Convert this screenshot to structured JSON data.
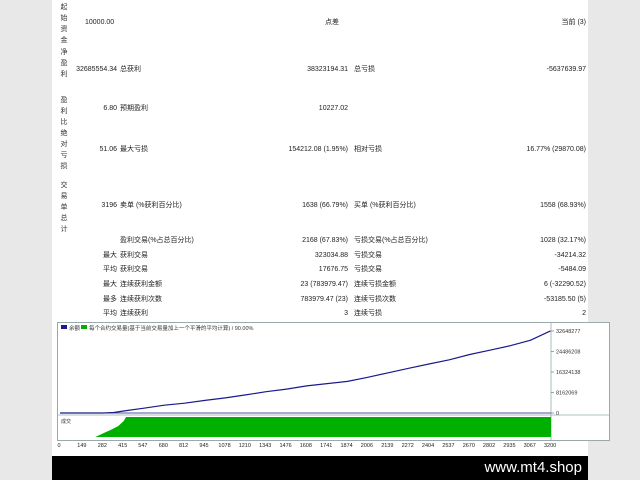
{
  "sidebar_labels": [
    "起始资金",
    "净盈利",
    "盈利比",
    "绝对亏损",
    "交易单总计"
  ],
  "stats": {
    "initial_deposit": "10000.00",
    "spread_label": "点差",
    "spread_value": "当前 (3)",
    "net_profit": "32685554.34",
    "gross_profit_label": "总获利",
    "gross_profit": "38323194.31",
    "gross_loss_label": "总亏损",
    "gross_loss": "-5637639.97",
    "profit_factor": "6.80",
    "expected_payoff_label": "预期盈利",
    "expected_payoff": "10227.02",
    "absolute_drawdown": "51.06",
    "maximal_drawdown_label": "最大亏损",
    "maximal_drawdown": "154212.08 (1.95%)",
    "relative_drawdown_label": "相对亏损",
    "relative_drawdown": "16.77% (29870.08)",
    "total_trades": "3196",
    "short_label": "卖单 (%获利百分比)",
    "short_value": "1638 (66.79%)",
    "long_label": "买单 (%获利百分比)",
    "long_value": "1558 (68.93%)",
    "profit_trades_label": "盈利交易(%占总百分比)",
    "profit_trades": "2168 (67.83%)",
    "loss_trades_label": "亏损交易(%占总百分比)",
    "loss_trades": "1028 (32.17%)"
  },
  "detail_rows": [
    {
      "prefix": "最大",
      "l1": "获利交易",
      "v1": "323034.88",
      "l2": "亏损交易",
      "v2": "-34214.32"
    },
    {
      "prefix": "平均",
      "l1": "获利交易",
      "v1": "17676.75",
      "l2": "亏损交易",
      "v2": "-5484.09"
    },
    {
      "prefix": "最大",
      "l1": "连续获利金额",
      "v1": "23 (783979.47)",
      "l2": "连续亏损金额",
      "v2": "6 (-32290.52)"
    },
    {
      "prefix": "最多",
      "l1": "连续获利次数",
      "v1": "783979.47 (23)",
      "l2": "连续亏损次数",
      "v2": "-53185.50 (5)"
    },
    {
      "prefix": "平均",
      "l1": "连续获利",
      "v1": "3",
      "l2": "连续亏损",
      "v2": "2"
    }
  ],
  "chart_data": {
    "type": "line",
    "legend_balance": "余额",
    "legend_text": "每个合约交易量(基于当前交易量加上一个平滑的平均计算) / 90.00%",
    "volume_label": "成交",
    "x_ticks": [
      "0",
      "149",
      "282",
      "415",
      "547",
      "680",
      "812",
      "945",
      "1078",
      "1210",
      "1343",
      "1476",
      "1608",
      "1741",
      "1874",
      "2006",
      "2139",
      "2272",
      "2404",
      "2537",
      "2670",
      "2802",
      "2935",
      "3067",
      "3200"
    ],
    "y_ticks": [
      "32648277",
      "24486208",
      "16324138",
      "8162069",
      "0"
    ],
    "ylim": [
      0,
      32648277
    ],
    "xlim": [
      0,
      3200
    ],
    "balance_series": [
      [
        0,
        0
      ],
      [
        149,
        0
      ],
      [
        282,
        0
      ],
      [
        350,
        200000
      ],
      [
        415,
        800000
      ],
      [
        547,
        1900000
      ],
      [
        680,
        3100000
      ],
      [
        812,
        3900000
      ],
      [
        945,
        5000000
      ],
      [
        1078,
        6000000
      ],
      [
        1210,
        7200000
      ],
      [
        1343,
        8500000
      ],
      [
        1476,
        9500000
      ],
      [
        1608,
        10800000
      ],
      [
        1741,
        11700000
      ],
      [
        1874,
        12600000
      ],
      [
        2006,
        14200000
      ],
      [
        2139,
        16000000
      ],
      [
        2272,
        17800000
      ],
      [
        2404,
        19500000
      ],
      [
        2537,
        21200000
      ],
      [
        2670,
        23300000
      ],
      [
        2802,
        25000000
      ],
      [
        2935,
        26800000
      ],
      [
        3067,
        29000000
      ],
      [
        3196,
        32685554
      ]
    ],
    "volume_fill": [
      [
        0,
        0
      ],
      [
        230,
        0
      ],
      [
        300,
        0.25
      ],
      [
        330,
        0.35
      ],
      [
        380,
        0.55
      ],
      [
        415,
        0.8
      ],
      [
        430,
        1
      ],
      [
        3200,
        1
      ]
    ],
    "colors": {
      "balance": "#1a1a8c",
      "volume": "#00b000",
      "axis": "#666666"
    }
  }
}
